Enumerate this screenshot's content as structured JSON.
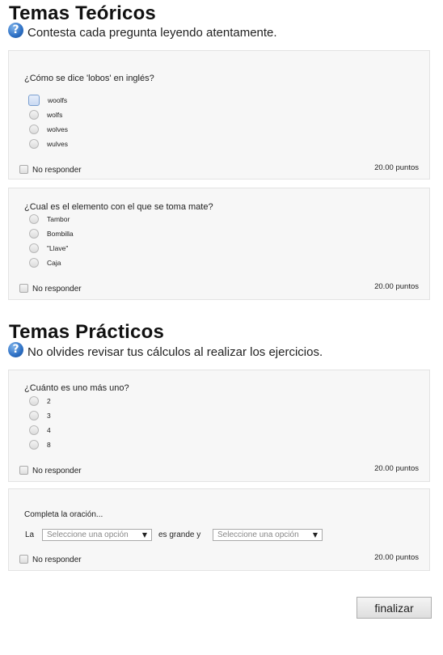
{
  "sections": [
    {
      "title": "Temas Teóricos",
      "intro": "Contesta cada pregunta leyendo atentamente.",
      "questions": [
        {
          "text": "¿Cómo se dice 'lobos' en inglés?",
          "options": [
            "woolfs",
            "wolfs",
            "wolves",
            "wulves"
          ],
          "no_answer": "No responder",
          "points": "20.00 puntos"
        },
        {
          "text": "¿Cual es el elemento con el que se toma mate?",
          "options": [
            "Tambor",
            "Bombilla",
            "\"Llave\"",
            "Caja"
          ],
          "no_answer": "No responder",
          "points": "20.00 puntos"
        }
      ]
    },
    {
      "title": "Temas Prácticos",
      "intro": "No olvides revisar tus cálculos al realizar los ejercicios.",
      "questions": [
        {
          "text": "¿Cuánto es uno más uno?",
          "options": [
            "2",
            "3",
            "4",
            "8"
          ],
          "no_answer": "No responder",
          "points": "20.00 puntos"
        },
        {
          "text": "Completa la oración...",
          "sentence": {
            "before": "La",
            "middle": "es grande y"
          },
          "select_placeholder": "Seleccione una opción",
          "no_answer": "No responder",
          "points": "20.00 puntos"
        }
      ]
    }
  ],
  "help_icon_glyph": "?",
  "select_arrow_glyph": "▼",
  "finish_label": "finalizar"
}
